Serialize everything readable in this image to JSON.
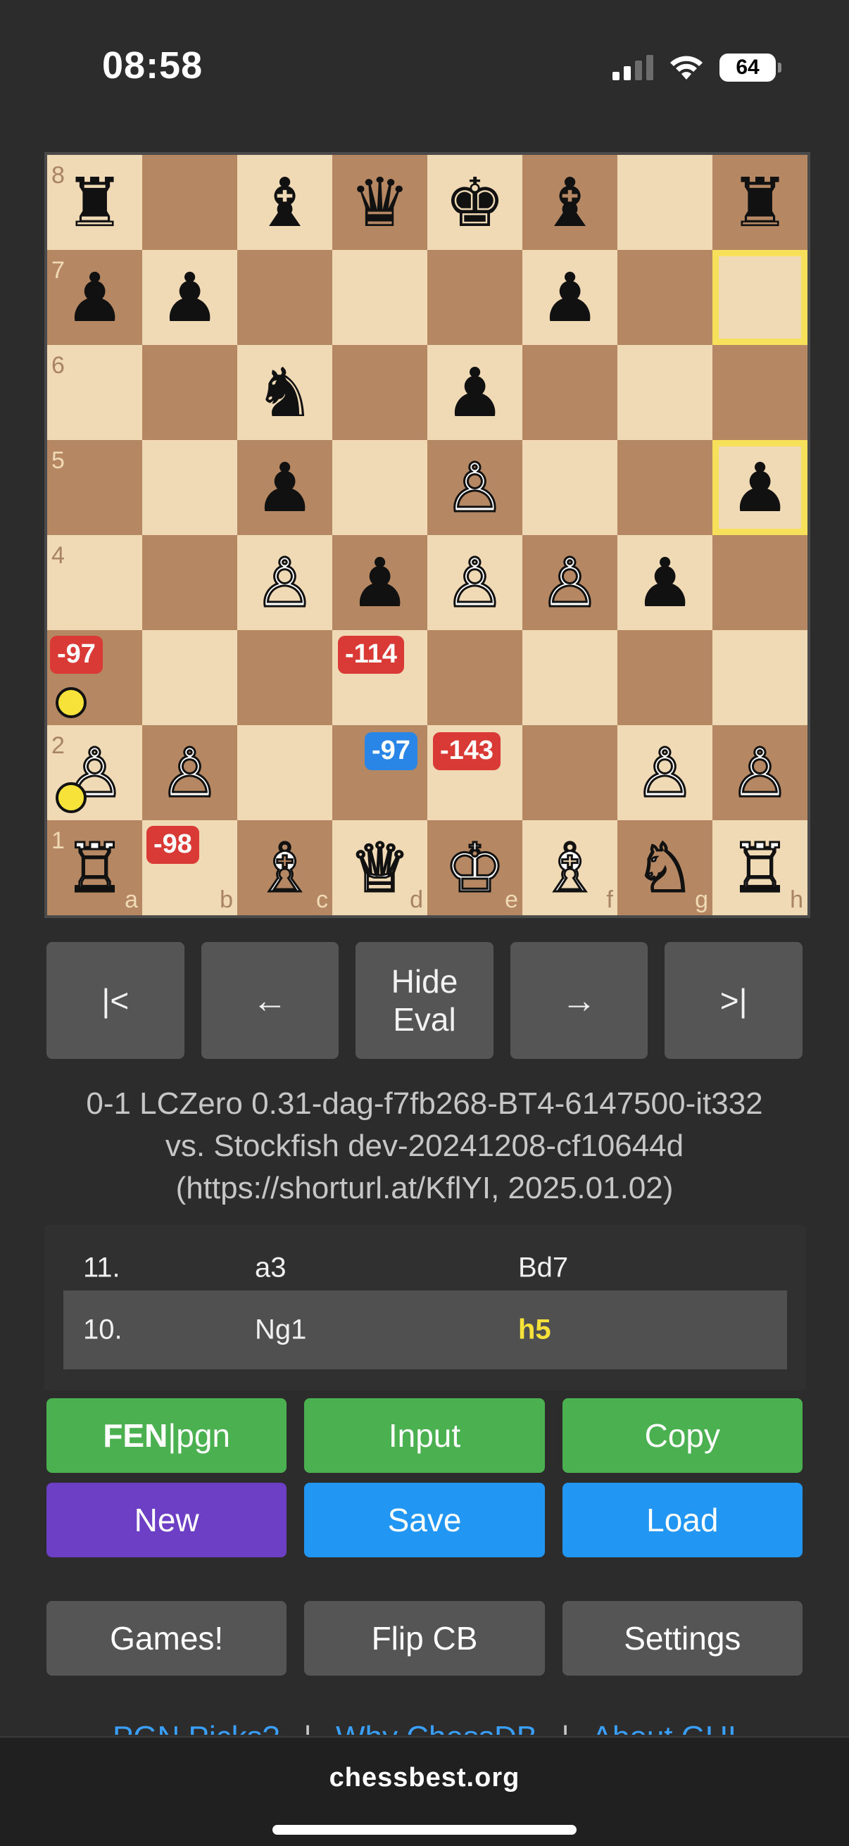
{
  "status_bar": {
    "time": "08:58",
    "battery": "64"
  },
  "board": {
    "ranks": [
      "8",
      "7",
      "6",
      "5",
      "4",
      "3",
      "2",
      "1"
    ],
    "files": [
      "a",
      "b",
      "c",
      "d",
      "e",
      "f",
      "g",
      "h"
    ],
    "squares": [
      [
        "♜",
        "",
        "♝",
        "♛",
        "♚",
        "♝",
        "",
        "♜"
      ],
      [
        "♟",
        "♟",
        "",
        "",
        "",
        "♟",
        "",
        ""
      ],
      [
        "",
        "",
        "♞",
        "",
        "♟",
        "",
        "",
        ""
      ],
      [
        "",
        "",
        "♟",
        "",
        "♙",
        "",
        "",
        "♟"
      ],
      [
        "",
        "",
        "♙",
        "♟",
        "♙",
        "♙",
        "♟",
        ""
      ],
      [
        "",
        "",
        "",
        "",
        "",
        "",
        "",
        ""
      ],
      [
        "♙",
        "♙",
        "",
        "",
        "",
        "",
        "♙",
        "♙"
      ],
      [
        "♖",
        "",
        "♗",
        "♕",
        "♔",
        "♗",
        "♘",
        "♖"
      ]
    ],
    "highlighted_squares": [
      "h7",
      "h5"
    ],
    "eval_badges": [
      {
        "square": "a3",
        "value": "-97",
        "color": "red"
      },
      {
        "square": "d3",
        "value": "-114",
        "color": "red"
      },
      {
        "square": "d2",
        "value": "-97",
        "color": "blue"
      },
      {
        "square": "e2",
        "value": "-143",
        "color": "red"
      },
      {
        "square": "b1",
        "value": "-98",
        "color": "red"
      }
    ],
    "markers": [
      "a3",
      "a2"
    ],
    "colors": {
      "light": "#f0d9b5",
      "dark": "#b58863",
      "highlight": "#f7e15a"
    }
  },
  "nav": {
    "first": "|<",
    "prev": "←",
    "hide_eval_line1": "Hide",
    "hide_eval_line2": "Eval",
    "next": "→",
    "last": ">|"
  },
  "game_info": {
    "line1": "0-1 LCZero 0.31-dag-f7fb268-BT4-6147500-it332",
    "line2": "vs. Stockfish dev-20241208-cf10644d",
    "line3": "(https://shorturl.at/KflYI, 2025.01.02)"
  },
  "moves": [
    {
      "num": "11.",
      "white": "a3",
      "black": "Bd7",
      "active": false
    },
    {
      "num": "10.",
      "white": "Ng1",
      "black": "h5",
      "active": true
    }
  ],
  "buttons": {
    "fen_bold": "FEN",
    "fen_rest": "|pgn",
    "input": "Input",
    "copy": "Copy",
    "new": "New",
    "save": "Save",
    "load": "Load",
    "games": "Games!",
    "flip": "Flip CB",
    "settings": "Settings"
  },
  "footer_links": {
    "pgn_picks": "PGN Picks?",
    "why": "Why ChessDB",
    "about": "About GUI",
    "separator": "|"
  },
  "browser": {
    "url": "chessbest.org"
  }
}
